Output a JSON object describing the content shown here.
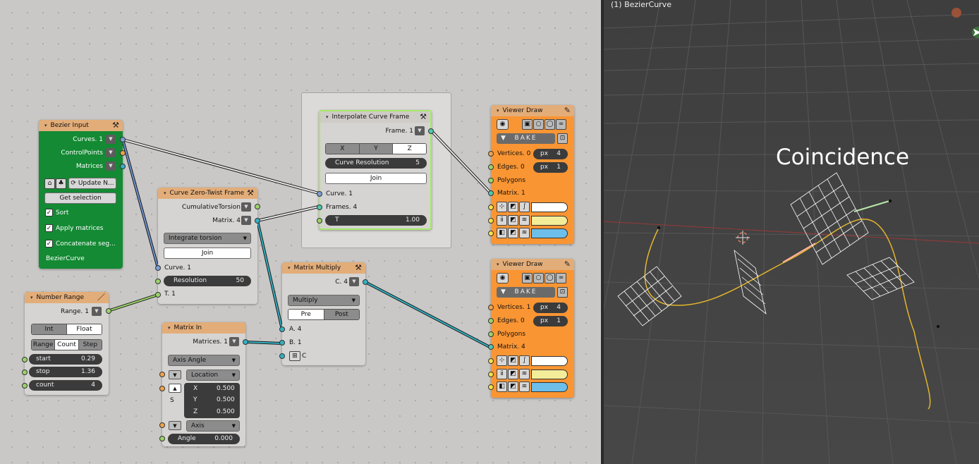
{
  "viewport": {
    "object_label": "(1) BezierCurve",
    "overlay_text": "Coincidence"
  },
  "bezier_input": {
    "title": "Bezier Input",
    "outputs": [
      "Curves. 1",
      "ControlPoints",
      "Matrices"
    ],
    "update_label": "Update N...",
    "get_selection_label": "Get selection",
    "checks": [
      {
        "label": "Sort",
        "checked": true
      },
      {
        "label": "Apply matrices",
        "checked": true
      },
      {
        "label": "Concatenate seg...",
        "checked": true
      }
    ],
    "object_name": "BezierCurve"
  },
  "number_range": {
    "title": "Number Range",
    "output": "Range. 1",
    "type_options": [
      "Int",
      "Float"
    ],
    "type_selected": "Float",
    "mode_options": [
      "Range",
      "Count",
      "Step"
    ],
    "mode_selected": "Count",
    "fields": [
      {
        "label": "start",
        "value": "0.29"
      },
      {
        "label": "stop",
        "value": "1.36"
      },
      {
        "label": "count",
        "value": "4"
      }
    ]
  },
  "curve_zero_twist": {
    "title": "Curve Zero-Twist Frame",
    "outputs": [
      "CumulativeTorsion",
      "Matrix. 4"
    ],
    "mode": "Integrate torsion",
    "join_label": "Join",
    "inputs": [
      "Curve. 1",
      "T. 1"
    ],
    "resolution_label": "Resolution",
    "resolution_value": "50"
  },
  "interpolate_curve_frame": {
    "title": "Interpolate Curve Frame",
    "output": "Frame. 1",
    "axis_options": [
      "X",
      "Y",
      "Z"
    ],
    "axis_selected": "Z",
    "curve_resolution_label": "Curve Resolution",
    "curve_resolution_value": "5",
    "join_label": "Join",
    "inputs": [
      "Curve. 1",
      "Frames. 4"
    ],
    "t_label": "T",
    "t_value": "1.00"
  },
  "matrix_multiply": {
    "title": "Matrix Multiply",
    "output": "C. 4",
    "operation": "Multiply",
    "order_options": [
      "Pre",
      "Post"
    ],
    "order_selected": "Post",
    "inputs": [
      "A. 4",
      "B. 1",
      "C"
    ]
  },
  "matrix_in": {
    "title": "Matrix In",
    "output": "Matrices. 1",
    "mode": "Axis Angle",
    "location_label": "Location",
    "scale_label": "S",
    "vector": [
      {
        "label": "X",
        "value": "0.500"
      },
      {
        "label": "Y",
        "value": "0.500"
      },
      {
        "label": "Z",
        "value": "0.500"
      }
    ],
    "axis_label": "Axis",
    "angle_label": "Angle",
    "angle_value": "0.000"
  },
  "viewer_draw_1": {
    "title": "Viewer Draw",
    "bake_label": "BAKE",
    "inputs": [
      "Vertices. 0",
      "Edges. 0",
      "Polygons",
      "Matrix. 1"
    ],
    "vertex_px_label": "px",
    "vertex_px_value": "4",
    "edge_px_label": "px",
    "edge_px_value": "1"
  },
  "viewer_draw_2": {
    "title": "Viewer Draw",
    "bake_label": "BAKE",
    "inputs": [
      "Vertices. 1",
      "Edges. 0",
      "Polygons",
      "Matrix. 4"
    ],
    "vertex_px_label": "px",
    "vertex_px_value": "4",
    "edge_px_label": "px",
    "edge_px_value": "1"
  },
  "colors": {
    "bezier_node_bg": "#138a33",
    "viewer_node_bg": "#fa9533",
    "node_header": "#e3ad79",
    "vertex_color": "#ffffff",
    "edge_color": "#f3ed9a",
    "face_color": "#6dbfe9",
    "curve_color": "#e3b52d"
  }
}
